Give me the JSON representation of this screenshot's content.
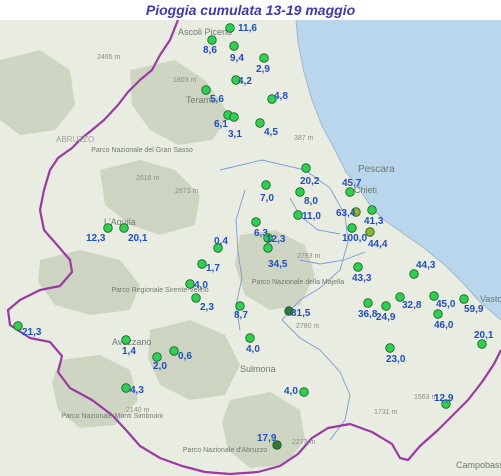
{
  "title": "Pioggia cumulata 13-19 maggio",
  "colors": {
    "title": "#3b3bb3",
    "value_label": "#1f4fbf",
    "station_high": "#2bd14f",
    "station_low": "#2f7a3a",
    "station_mid": "#8db52f",
    "region_border": "#9b3aa3",
    "river_basin": "#7b9cd6",
    "sea": "#b9d6ec",
    "land": "#e9ece1",
    "relief": "#c9d2bd"
  },
  "place_labels": [
    "Ascoli Piceno",
    "Teramo",
    "Pescara",
    "Chieti",
    "L'Aquila",
    "Avezzano",
    "Sulmona",
    "Vasto",
    "Campobasso",
    "ABRUZZO",
    "Parco Nazionale del Gran Sasso",
    "Parco Regionale Sirente-Velino",
    "Parco Nazionale della Majella",
    "Parco Nazionale Monti Simbruini",
    "Parco Nazionale d'Abruzzo"
  ],
  "elevation_labels": [
    "2465 m",
    "1803 m",
    "2616 m",
    "2873 m",
    "2140 m",
    "2793 m",
    "2780 m",
    "2273 m",
    "1731 m",
    "1563 m",
    "387 m"
  ],
  "stations": [
    {
      "value": "11,6",
      "quality": "high"
    },
    {
      "value": "8,6",
      "quality": "high"
    },
    {
      "value": "9,4",
      "quality": "high"
    },
    {
      "value": "2,9",
      "quality": "high"
    },
    {
      "value": "4,2",
      "quality": "high"
    },
    {
      "value": "5,6",
      "quality": "high"
    },
    {
      "value": "4,8",
      "quality": "high"
    },
    {
      "value": "6,1",
      "quality": "high"
    },
    {
      "value": "3,1",
      "quality": "high"
    },
    {
      "value": "4,5",
      "quality": "high"
    },
    {
      "value": "20,2",
      "quality": "high"
    },
    {
      "value": "7,0",
      "quality": "high"
    },
    {
      "value": "8,0",
      "quality": "high"
    },
    {
      "value": "45,7",
      "quality": "high"
    },
    {
      "value": "63,4",
      "quality": "mid"
    },
    {
      "value": "41,3",
      "quality": "high"
    },
    {
      "value": "11,0",
      "quality": "high"
    },
    {
      "value": "100,0",
      "quality": "high"
    },
    {
      "value": "44,4",
      "quality": "mid"
    },
    {
      "value": "12,3",
      "quality": "high"
    },
    {
      "value": "20,1",
      "quality": "high"
    },
    {
      "value": "6,3",
      "quality": "high"
    },
    {
      "value": "12,3",
      "quality": "high"
    },
    {
      "value": "0,4",
      "quality": "high"
    },
    {
      "value": "34,5",
      "quality": "high"
    },
    {
      "value": "1,7",
      "quality": "high"
    },
    {
      "value": "44,3",
      "quality": "high"
    },
    {
      "value": "43,3",
      "quality": "high"
    },
    {
      "value": "4,0",
      "quality": "high"
    },
    {
      "value": "2,3",
      "quality": "high"
    },
    {
      "value": "31,5",
      "quality": "low"
    },
    {
      "value": "32,8",
      "quality": "high"
    },
    {
      "value": "45,0",
      "quality": "high"
    },
    {
      "value": "59,9",
      "quality": "high"
    },
    {
      "value": "8,7",
      "quality": "high"
    },
    {
      "value": "36,8",
      "quality": "high"
    },
    {
      "value": "24,9",
      "quality": "high"
    },
    {
      "value": "46,0",
      "quality": "high"
    },
    {
      "value": "21,3",
      "quality": "high"
    },
    {
      "value": "1,4",
      "quality": "high"
    },
    {
      "value": "0,6",
      "quality": "high"
    },
    {
      "value": "2,0",
      "quality": "high"
    },
    {
      "value": "4,0",
      "quality": "high"
    },
    {
      "value": "20,1",
      "quality": "high"
    },
    {
      "value": "23,0",
      "quality": "high"
    },
    {
      "value": "4,3",
      "quality": "high"
    },
    {
      "value": "4,0",
      "quality": "high"
    },
    {
      "value": "12,9",
      "quality": "high"
    },
    {
      "value": "17,9",
      "quality": "low"
    }
  ]
}
